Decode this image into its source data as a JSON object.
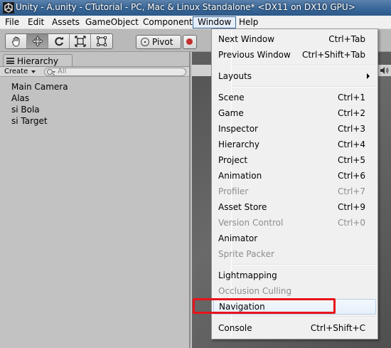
{
  "titlebar": {
    "title": "Unity - A.unity - CTutorial - PC, Mac & Linux Standalone* <DX11 on DX10 GPU>",
    "icon": "unity-logo-icon"
  },
  "menubar": {
    "items": [
      "File",
      "Edit",
      "Assets",
      "GameObject",
      "Component",
      "Window",
      "Help"
    ],
    "active": "Window"
  },
  "toolbar": {
    "tools": [
      "hand-icon",
      "move-icon",
      "rotate-icon",
      "scale-icon",
      "rect-icon"
    ],
    "selected_tool": "move-icon",
    "pivot_label": "Pivot"
  },
  "hierarchy": {
    "tab_label": "Hierarchy",
    "create_label": "Create",
    "search_placeholder": "All",
    "items": [
      "Main Camera",
      "Alas",
      "si Bola",
      "si Target"
    ]
  },
  "window_menu": {
    "groups": [
      [
        {
          "label": "Next Window",
          "shortcut": "Ctrl+Tab",
          "enabled": true
        },
        {
          "label": "Previous Window",
          "shortcut": "Ctrl+Shift+Tab",
          "enabled": true
        }
      ],
      [
        {
          "label": "Layouts",
          "shortcut": "",
          "enabled": true,
          "submenu": true
        }
      ],
      [
        {
          "label": "Scene",
          "shortcut": "Ctrl+1",
          "enabled": true
        },
        {
          "label": "Game",
          "shortcut": "Ctrl+2",
          "enabled": true
        },
        {
          "label": "Inspector",
          "shortcut": "Ctrl+3",
          "enabled": true
        },
        {
          "label": "Hierarchy",
          "shortcut": "Ctrl+4",
          "enabled": true
        },
        {
          "label": "Project",
          "shortcut": "Ctrl+5",
          "enabled": true
        },
        {
          "label": "Animation",
          "shortcut": "Ctrl+6",
          "enabled": true
        },
        {
          "label": "Profiler",
          "shortcut": "Ctrl+7",
          "enabled": false
        },
        {
          "label": "Asset Store",
          "shortcut": "Ctrl+9",
          "enabled": true
        },
        {
          "label": "Version Control",
          "shortcut": "Ctrl+0",
          "enabled": false
        },
        {
          "label": "Animator",
          "shortcut": "",
          "enabled": true
        },
        {
          "label": "Sprite Packer",
          "shortcut": "",
          "enabled": false
        }
      ],
      [
        {
          "label": "Lightmapping",
          "shortcut": "",
          "enabled": true
        },
        {
          "label": "Occlusion Culling",
          "shortcut": "",
          "enabled": false
        },
        {
          "label": "Navigation",
          "shortcut": "",
          "enabled": true,
          "hover": true
        }
      ],
      [
        {
          "label": "Console",
          "shortcut": "Ctrl+Shift+C",
          "enabled": true
        }
      ]
    ]
  },
  "colors": {
    "highlight_box": "#e8141b",
    "disabled_text": "#8d8d8d",
    "titlebar": "#3b6a9c"
  }
}
